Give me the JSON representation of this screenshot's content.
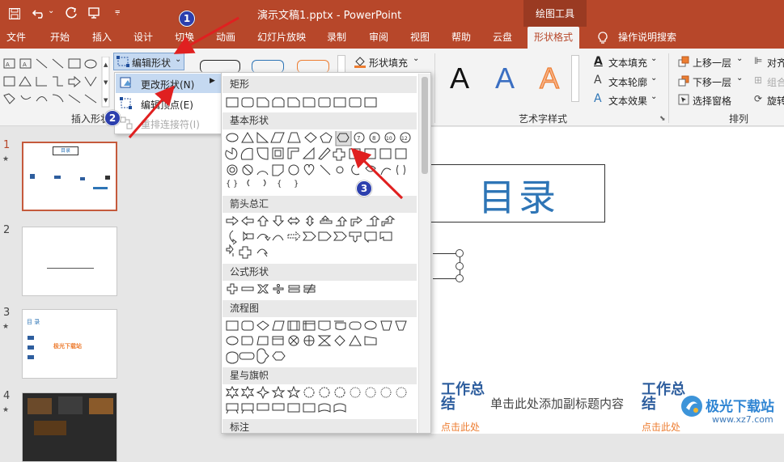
{
  "title_bar": {
    "doc_title": "演示文稿1.pptx - PowerPoint",
    "context_tab": "绘图工具"
  },
  "tabs": [
    "文件",
    "开始",
    "插入",
    "设计",
    "切换",
    "动画",
    "幻灯片放映",
    "录制",
    "审阅",
    "视图",
    "帮助",
    "云盘",
    "形状格式"
  ],
  "active_tab": "形状格式",
  "tell_me": "操作说明搜索",
  "ribbon": {
    "insert_shapes_label": "插入形状",
    "edit_shape_button": "编辑形状",
    "shape_fill": "形状填充",
    "wordart_label": "艺术字样式",
    "text_fill": "文本填充",
    "text_outline": "文本轮廓",
    "text_effects": "文本效果",
    "bring_forward": "上移一层",
    "send_backward": "下移一层",
    "selection_pane": "选择窗格",
    "arrange_label": "排列",
    "align": "对齐",
    "group": "组合",
    "rotate": "旋转",
    "wordart_letter": "A"
  },
  "edit_shape_menu": {
    "change_shape": "更改形状(N)",
    "edit_points": "编辑顶点(E)",
    "reroute": "重排连接符(I)"
  },
  "gallery": {
    "sections": [
      "矩形",
      "基本形状",
      "箭头总汇",
      "公式形状",
      "流程图",
      "星与旗帜",
      "标注"
    ],
    "octagon_labels": [
      "7",
      "8",
      "10",
      "12"
    ],
    "braces": [
      "{",
      "}"
    ]
  },
  "slides": {
    "numbers": [
      "1",
      "2",
      "3",
      "4"
    ],
    "thumb1_title": "目录",
    "thumb3_title": "目 录",
    "thumb3_highlight": "极光下载站"
  },
  "slide": {
    "title": "目录",
    "work_summary": "工作总结",
    "subtitle_placeholder": "单击此处添加副标题内容",
    "click_here": "点击此处",
    "click_here_right": "点击此处"
  },
  "badges": [
    "1",
    "2",
    "3"
  ],
  "watermark": {
    "name": "极光下载站",
    "url": "www.xz7.com"
  },
  "colors": {
    "accent": "#b7472a",
    "badge": "#2c3fae",
    "arrow": "#e02020",
    "title_blue": "#2e75b6",
    "summary_blue": "#2e5e9e",
    "orange": "#ed7d31"
  }
}
